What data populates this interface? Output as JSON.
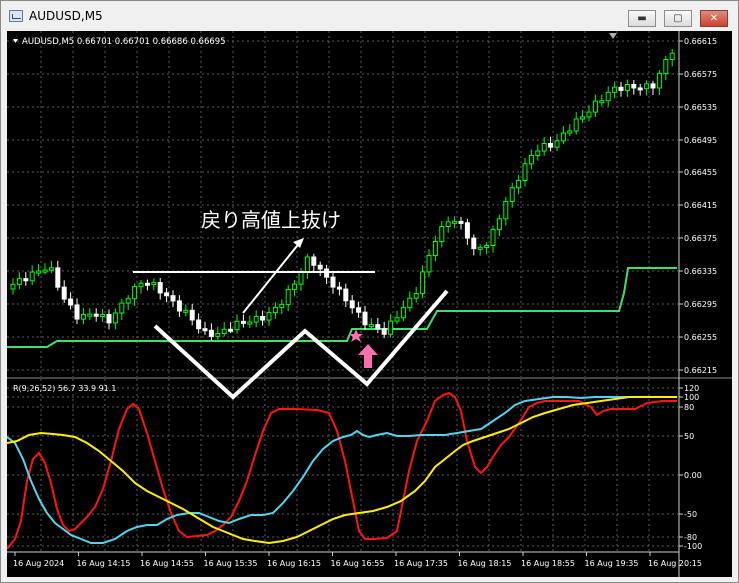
{
  "window": {
    "title": "AUDUSD,M5",
    "buttons": {
      "minimize": "▬",
      "maximize": "▢",
      "close": "✕"
    }
  },
  "chart": {
    "header": "AUDUSD,M5  0.66701 0.66701 0.66686 0.66695",
    "annotation_text": "戻り高値上抜け",
    "price_axis": [
      "0.66615",
      "0.66575",
      "0.66535",
      "0.66495",
      "0.66455",
      "0.66415",
      "0.66375",
      "0.66335",
      "0.66295",
      "0.66255",
      "0.66215"
    ],
    "time_axis": [
      "16 Aug 2024",
      "16 Aug 14:15",
      "16 Aug 14:55",
      "16 Aug 15:35",
      "16 Aug 16:15",
      "16 Aug 16:55",
      "16 Aug 17:35",
      "16 Aug 18:15",
      "16 Aug 18:55",
      "16 Aug 19:35",
      "16 Aug 20:15"
    ]
  },
  "indicator": {
    "header": "R(9,26,52) 56.7 33.9 91.1",
    "axis": [
      "120",
      "100",
      "80",
      "50",
      "0.00",
      "-50",
      "-80",
      "-100"
    ]
  },
  "colors": {
    "background": "#000000",
    "candle_up": "#00ff00",
    "candle_down": "#ffffff",
    "trail_line": "#3ee06a",
    "rci_short": "#ff1414",
    "rci_mid": "#4fd6ee",
    "rci_long": "#ffee00",
    "star": "#ff6fae",
    "arrow": "#ff6fae"
  },
  "icons": {
    "app": "chart-window-icon",
    "signal_star": "star-icon",
    "signal_arrow": "up-arrow-icon"
  }
}
